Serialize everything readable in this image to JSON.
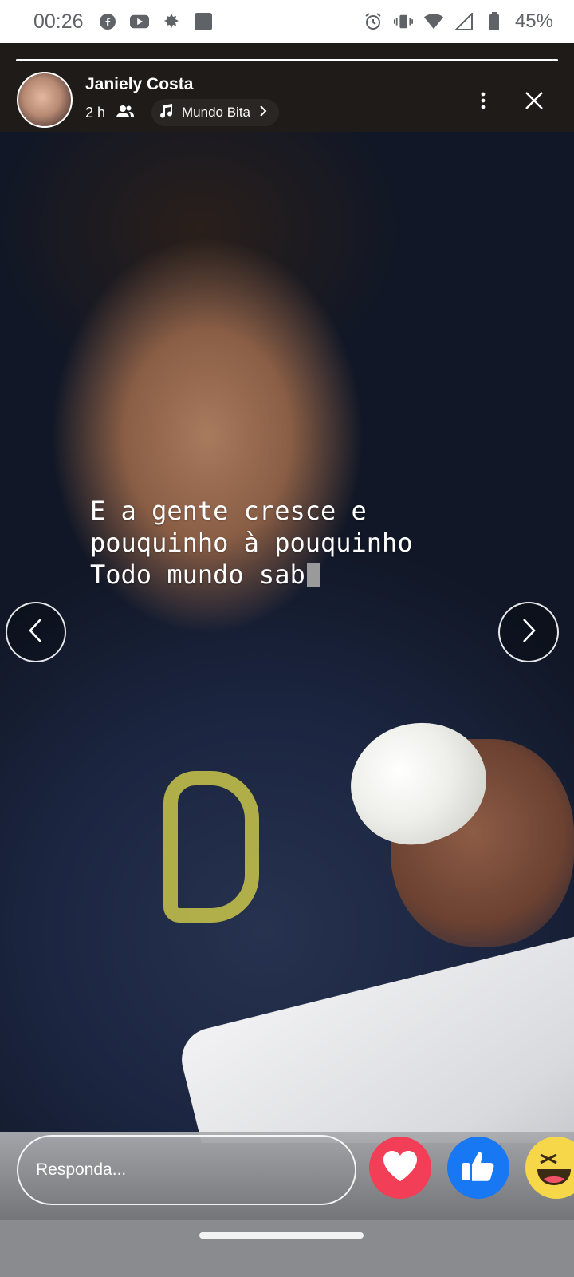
{
  "status_bar": {
    "time": "00:26",
    "battery": "45%",
    "left_icons": [
      "facebook-icon",
      "youtube-icon",
      "leaf-icon",
      "square-notification-icon"
    ],
    "right_icons": [
      "alarm-icon",
      "vibrate-icon",
      "wifi-icon",
      "signal-icon",
      "battery-icon"
    ]
  },
  "story": {
    "progress_fraction": 1.0,
    "author_name": "Janiely Costa",
    "time_ago": "2 h",
    "audience_icon": "friends-icon",
    "music_label": "Mundo Bita",
    "music_icon": "music-note-icon",
    "caption_line_1": "E a gente cresce e",
    "caption_line_2": "pouquinho à pouquinho",
    "caption_line_3": "Todo mundo sab"
  },
  "reply": {
    "placeholder": "Responda..."
  },
  "reactions": [
    {
      "name": "love",
      "icon": "heart-icon",
      "color": "#f33e58"
    },
    {
      "name": "like",
      "icon": "thumbs-up-icon",
      "color": "#1877f2"
    },
    {
      "name": "haha",
      "icon": "laughing-face-icon",
      "color": "#f7d74a"
    }
  ]
}
